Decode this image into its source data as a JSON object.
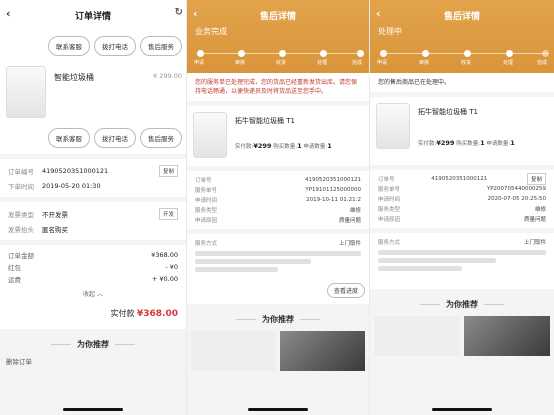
{
  "panel1": {
    "title": "订单详情",
    "btn_top": [
      "联系客服",
      "拨打电话",
      "售后服务"
    ],
    "product_name": "智能垃圾桶",
    "product_price": "¥ 299.00",
    "btn_mid": [
      "联系客服",
      "拨打电话",
      "售后服务"
    ],
    "rows": [
      {
        "k": "订单编号",
        "v": "4190520351000121",
        "tag": "复制"
      },
      {
        "k": "下单时间",
        "v": "2019-05-20 01:30",
        "tag": ""
      },
      {
        "k": "发票类型",
        "v": "不开发票",
        "tag": "开发"
      },
      {
        "k": "发票抬头",
        "v": "匿名购买",
        "tag": ""
      }
    ],
    "amounts": [
      {
        "k": "订单金额",
        "v": "¥368.00"
      },
      {
        "k": "红包",
        "v": "- ¥0"
      },
      {
        "k": "运费",
        "v": "+ ¥0.00"
      }
    ],
    "collapse": "收起 ︿",
    "paid_label": "实付款",
    "paid_value": "¥368.00",
    "recommend": "为你推荐",
    "delete": "删除订单"
  },
  "panel2": {
    "title": "售后详情",
    "status": "业务完成",
    "steps": [
      "申请",
      "审核",
      "收货",
      "处理",
      "完成"
    ],
    "notice": "您的服务单已处理完成，您的货品已经重新发货出库。请您保持电话畅通，以便快递员及时将货品送至您手中。",
    "product_name": "拓牛智能垃圾桶 T1",
    "paid_label": "实付款:",
    "paid_value": "¥299",
    "qty_label": "购买数量:",
    "qty_value": "1",
    "apply_label": "申请数量:",
    "apply_value": "1",
    "rows": [
      {
        "k": "订单号",
        "v": "4190520351000121"
      },
      {
        "k": "服务单号",
        "v": "YP19101125000000"
      },
      {
        "k": "申请时间",
        "v": "2019-10-11 01:21:2"
      },
      {
        "k": "服务类型",
        "v": "维修"
      },
      {
        "k": "申请原因",
        "v": "质量问题"
      }
    ],
    "rows2": [
      {
        "k": "服务方式",
        "v": "上门取件"
      }
    ],
    "progress_btn": "查看进度",
    "recommend": "为你推荐"
  },
  "panel3": {
    "title": "售后详情",
    "status": "处理中",
    "steps": [
      "申请",
      "审核",
      "收货",
      "处理",
      "完成"
    ],
    "notice": "您的售后商品已在处理中。",
    "product_name": "拓牛智能垃圾桶 T1",
    "paid_label": "实付款:",
    "paid_value": "¥299",
    "qty_label": "购买数量:",
    "qty_value": "1",
    "apply_label": "申请数量:",
    "apply_value": "1",
    "rows": [
      {
        "k": "订单号",
        "v": "4190520351000121",
        "tag": "复制"
      },
      {
        "k": "服务单号",
        "v": "YP200705440000259"
      },
      {
        "k": "申请时间",
        "v": "2020-07-05 20:25:50"
      },
      {
        "k": "服务类型",
        "v": "维修"
      },
      {
        "k": "申请原因",
        "v": "质量问题"
      }
    ],
    "rows2": [
      {
        "k": "服务方式",
        "v": "上门取件"
      }
    ],
    "recommend": "为你推荐"
  }
}
